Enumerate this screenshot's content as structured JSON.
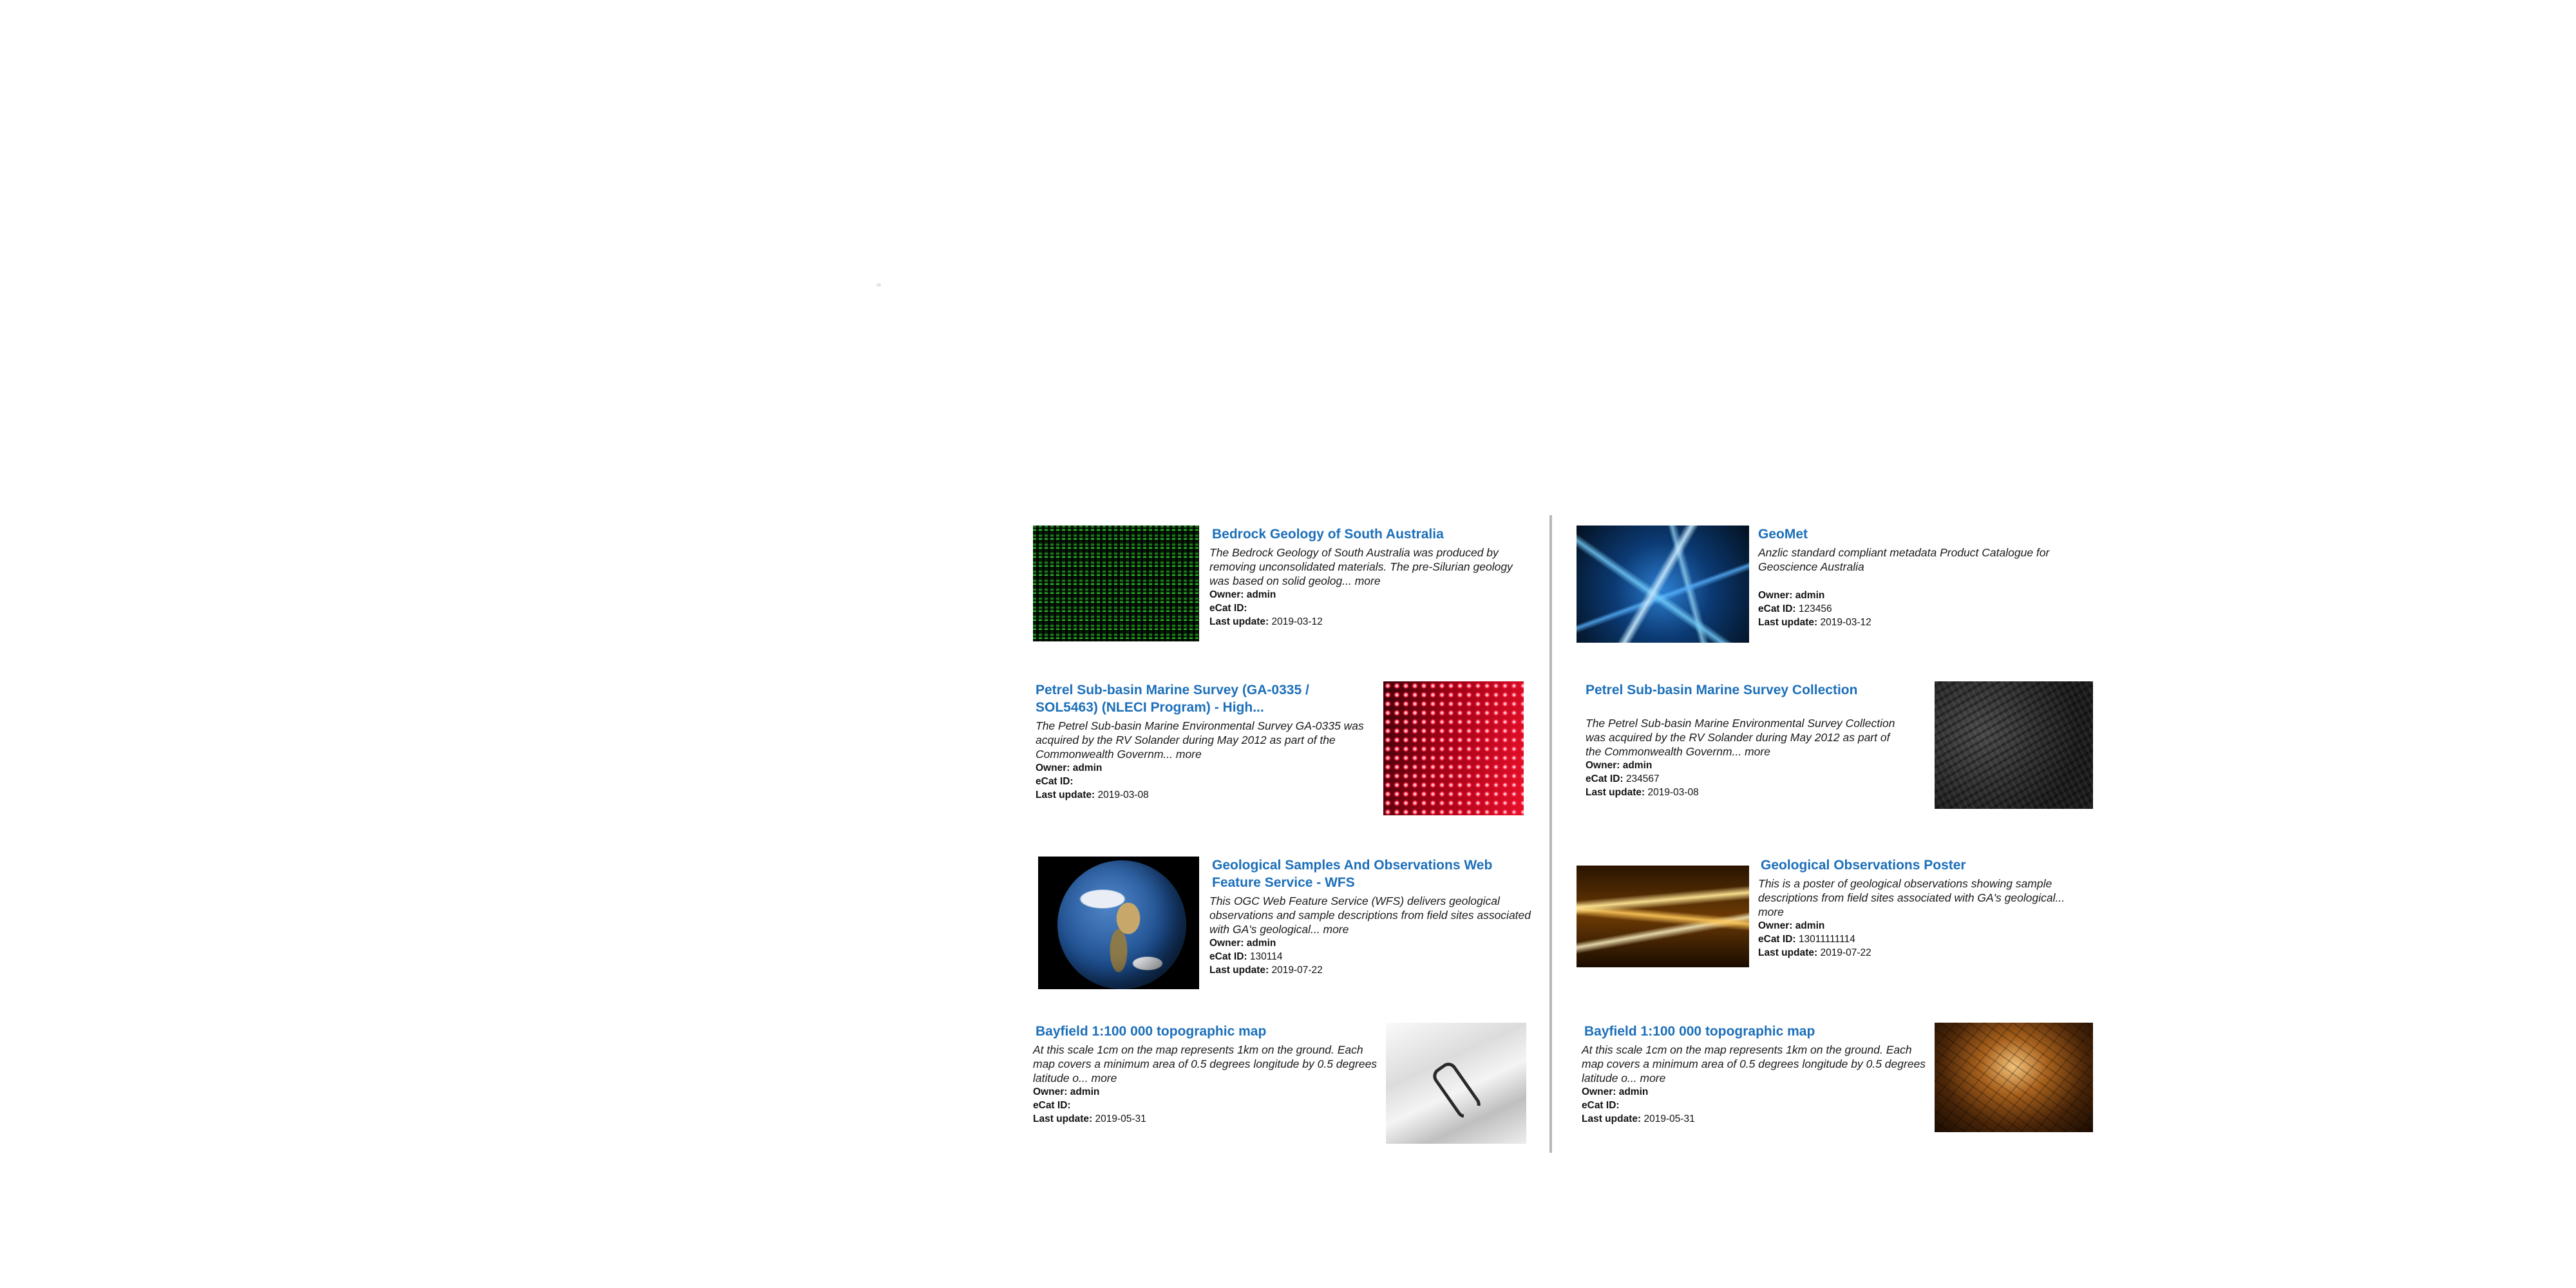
{
  "labels": {
    "owner": "Owner:",
    "ecat_id": "eCat ID:",
    "last_update": "Last update:",
    "more": "more"
  },
  "results": [
    {
      "title": "Bedrock Geology of South Australia",
      "description": "The Bedrock Geology of South Australia was produced by removing unconsolidated materials. The pre-Silurian geology was based on solid geolog...",
      "owner": "admin",
      "ecat_id": "",
      "last_update": "2019-03-12",
      "thumbnail": "green-code-rain-image"
    },
    {
      "title": "GeoMet",
      "description": "Anzlic standard compliant metadata Product Catalogue for Geoscience Australia",
      "owner": "admin",
      "ecat_id": "123456",
      "last_update": "2019-03-12",
      "thumbnail": "blue-network-lines-image"
    },
    {
      "title": "Petrel Sub-basin Marine Survey (GA-0335 / SOL5463) (NLECI Program) - High...",
      "description": "The Petrel Sub-basin Marine Environmental Survey GA-0335 was acquired by the RV Solander during May 2012 as part of the Commonwealth Governm...",
      "owner": "admin",
      "ecat_id": "",
      "last_update": "2019-03-08",
      "thumbnail": "red-led-wall-image"
    },
    {
      "title": "Petrel Sub-basin Marine Survey Collection",
      "description": "The Petrel Sub-basin Marine Environmental Survey Collection was acquired by the RV Solander during May 2012 as part of the Commonwealth Governm...",
      "owner": "admin",
      "ecat_id": "234567",
      "last_update": "2019-03-08",
      "thumbnail": "dark-rock-texture-image"
    },
    {
      "title": "Geological Samples And Observations Web Feature Service - WFS",
      "description": "This OGC Web Feature Service (WFS) delivers geological observations and sample descriptions from field sites associated with GA's geological...",
      "owner": "admin",
      "ecat_id": "130114",
      "last_update": "2019-07-22",
      "thumbnail": "earth-globe-image"
    },
    {
      "title": "Geological Observations Poster",
      "description": "This is a poster of geological observations showing sample descriptions from field sites associated with GA's geological...",
      "owner": "admin",
      "ecat_id": "13011111114",
      "last_update": "2019-07-22",
      "thumbnail": "golden-light-streaks-image"
    },
    {
      "title": "Bayfield 1:100 000 topographic map",
      "description": "At this scale 1cm on the map represents 1km on the ground. Each map covers a minimum area of 0.5 degrees longitude by 0.5 degrees latitude o...",
      "owner": "admin",
      "ecat_id": "",
      "last_update": "2019-05-31",
      "thumbnail": "paper-stack-clip-image"
    },
    {
      "title": "Bayfield 1:100 000 topographic map",
      "description": "At this scale 1cm on the map represents 1km on the ground. Each map covers a minimum area of 0.5 degrees longitude by 0.5 degrees latitude o...",
      "owner": "admin",
      "ecat_id": "",
      "last_update": "2019-05-31",
      "thumbnail": "cave-rock-texture-image"
    }
  ]
}
